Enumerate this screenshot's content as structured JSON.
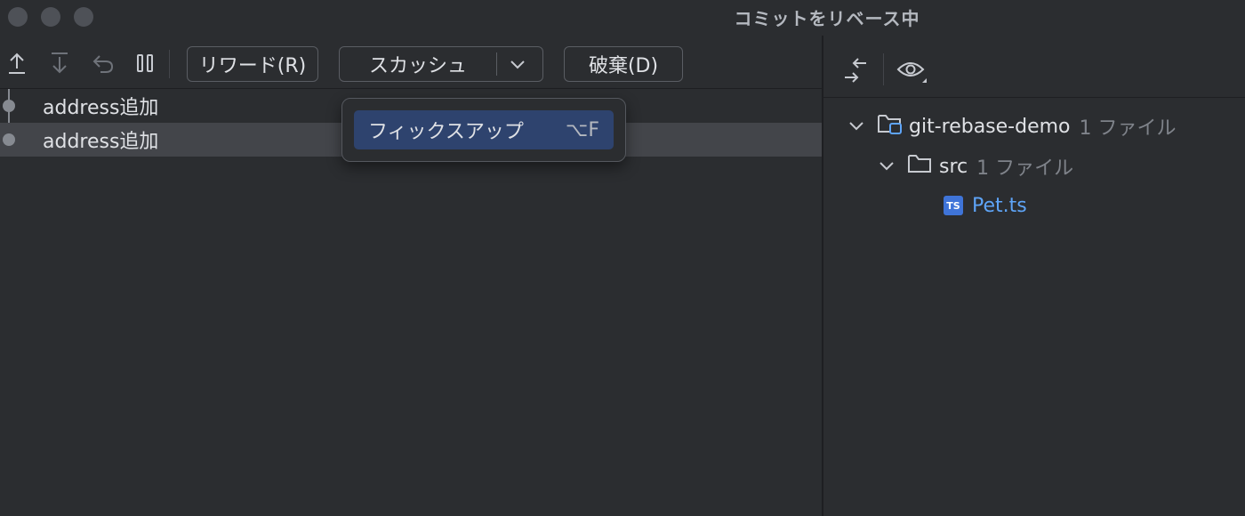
{
  "window": {
    "title": "コミットをリベース中"
  },
  "toolbar": {
    "icons": {
      "move_up": "arrow-up-icon",
      "move_down": "arrow-down-icon",
      "undo": "undo-icon",
      "pause": "pause-icon"
    },
    "reword_label": "リワード(R)",
    "squash_label": "スカッシュ",
    "drop_label": "破棄(D)"
  },
  "commits": [
    {
      "message": "address追加"
    },
    {
      "message": "address追加"
    }
  ],
  "popup": {
    "item_label": "フィックスアップ",
    "item_shortcut": "⌥F"
  },
  "changes_toolbar": {
    "icons": {
      "collapse": "collapse-arrows-icon",
      "view": "eye-icon"
    }
  },
  "tree": {
    "root": {
      "name": "git-rebase-demo",
      "count": "1 ファイル"
    },
    "folder": {
      "name": "src",
      "count": "1 ファイル"
    },
    "file": {
      "name": "Pet.ts",
      "badge": "TS"
    }
  },
  "colors": {
    "background": "#2b2d30",
    "selected_row": "#43454a",
    "popup_highlight": "#2e436e",
    "file_link": "#5ea4f7",
    "ts_badge": "#3f74d8"
  }
}
